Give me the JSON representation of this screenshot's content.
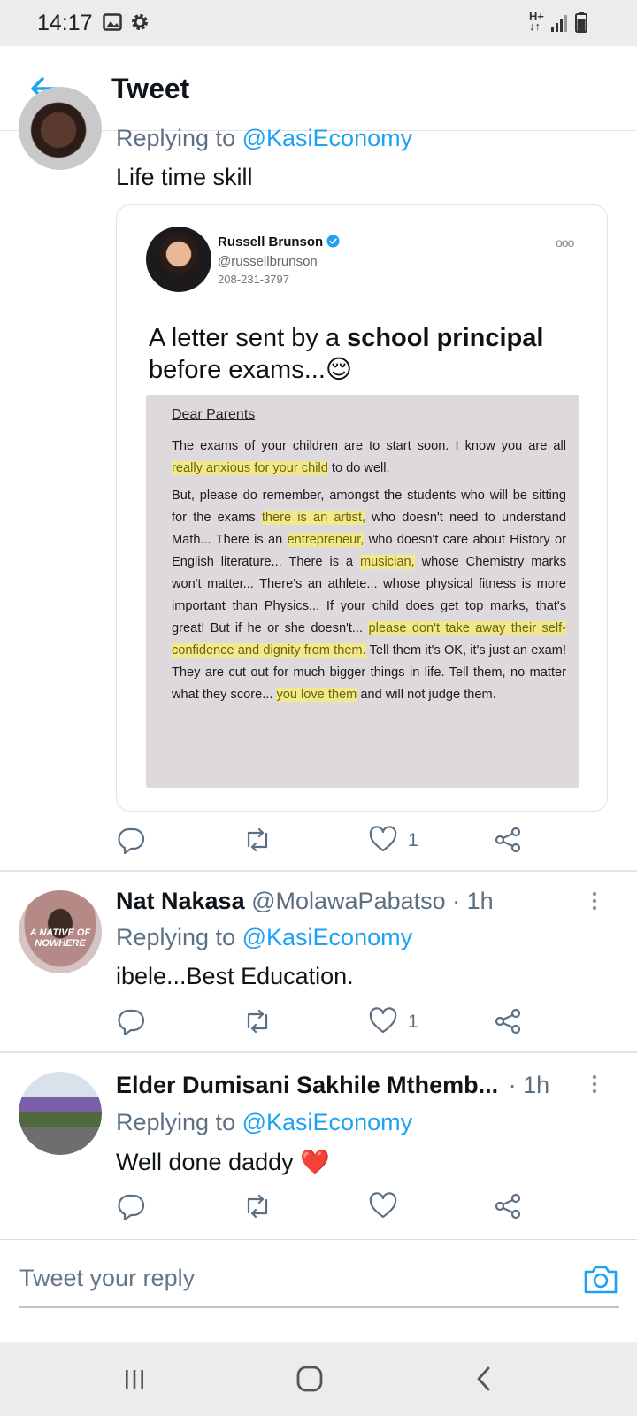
{
  "status_bar": {
    "time": "14:17",
    "icons": [
      "gallery-icon",
      "settings-gear-icon",
      "network-data-icon",
      "signal-icon",
      "battery-icon"
    ],
    "network_type": "H+"
  },
  "header": {
    "title": "Tweet",
    "back_icon": "arrow-left-icon"
  },
  "colors": {
    "accent": "#1da1f2",
    "secondary_text": "#5b7083",
    "highlight": "#f2e98a"
  },
  "tweets": [
    {
      "replying_to_label": "Replying to",
      "replying_to_handle": "@KasiEconomy",
      "text": "Life time skill",
      "embedded_card": {
        "author_name": "Russell Brunson",
        "author_handle": "@russellbrunson",
        "author_phone": "208-231-3797",
        "more": "ooo",
        "caption_pre": "A letter sent by a",
        "caption_bold": "school principal",
        "caption_post": "before exams...😌",
        "letter": {
          "salutation": "Dear Parents",
          "p1_a": "The exams of your children are to start soon. I know you are all",
          "p1_hl": "really anxious for your child",
          "p1_b": "to do well.",
          "p2_a": "But, please do remember, amongst the students who will be sitting for the exams",
          "p2_hl1": "there is an artist,",
          "p2_b": "who doesn't need to understand Math... There is an",
          "p2_hl2": "entrepreneur,",
          "p2_c": "who doesn't care about History or English literature... There is a",
          "p2_hl3": "musician,",
          "p2_d": "whose Chemistry marks won't matter... There's an athlete... whose physical fitness is more important than Physics... If your child does get top marks, that's great! But if he or she doesn't...",
          "p2_hl4": "please don't take away their self-confidence and dignity from them.",
          "p2_e": "Tell them it's OK, it's just an exam! They are cut out for much bigger things in life. Tell them, no matter what they score...",
          "p2_hl5": "you love them",
          "p2_f": "and will not judge them."
        }
      },
      "likes": "1"
    },
    {
      "name": "Nat Nakasa",
      "handle": "@MolawaPabatso",
      "time": "· 1h",
      "replying_to_label": "Replying to",
      "replying_to_handle": "@KasiEconomy",
      "text": "ibele...Best Education.",
      "avatar_text": "A NATIVE OF NOWHERE",
      "likes": "1"
    },
    {
      "name": "Elder Dumisani Sakhile Mthemb...",
      "time": "· 1h",
      "replying_to_label": "Replying to",
      "replying_to_handle": "@KasiEconomy",
      "text": "Well done daddy",
      "emoji": "❤️",
      "likes": ""
    }
  ],
  "reply_bar": {
    "placeholder": "Tweet your reply",
    "camera_icon": "camera-icon"
  },
  "nav_bar": {
    "icons": [
      "recent-apps-icon",
      "home-icon",
      "back-chevron-icon"
    ]
  }
}
